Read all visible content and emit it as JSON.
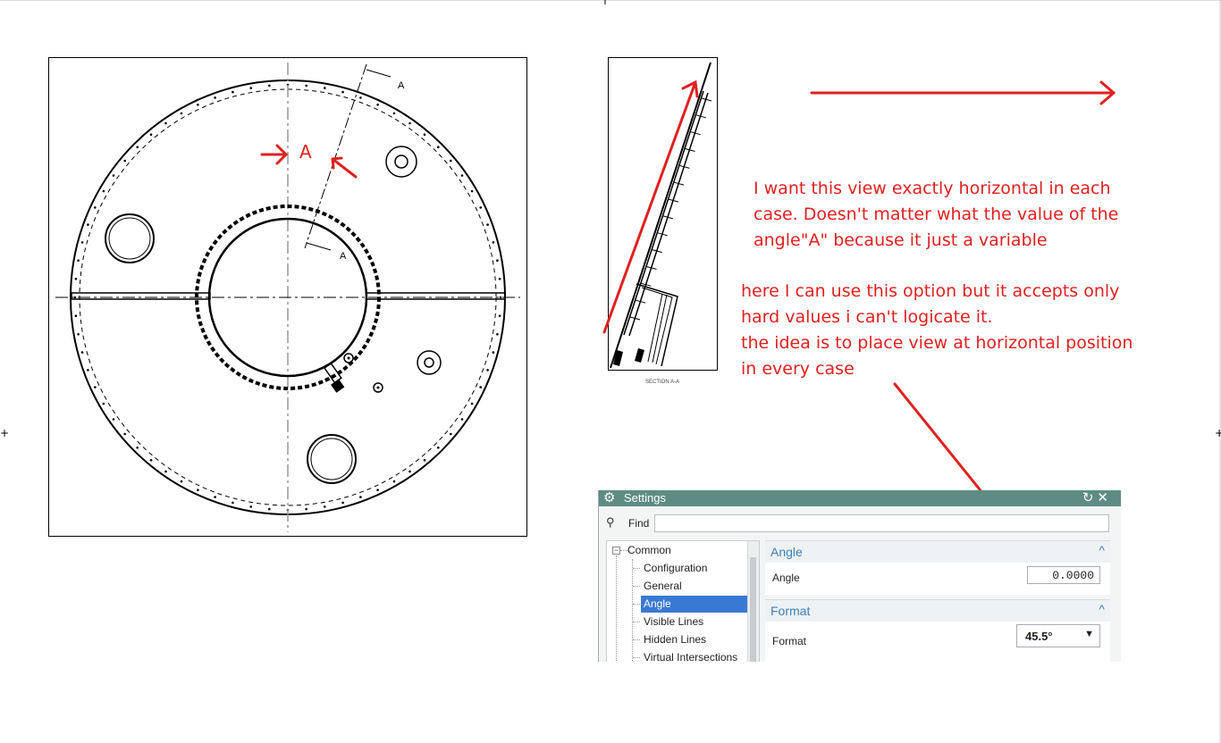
{
  "drawing": {
    "section_marker_A": "A",
    "cut_label_top": "A",
    "cut_label_bottom": "A",
    "section_caption": "SECTION A-A"
  },
  "notes": {
    "note1": "I want this view exactly horizontal in each\ncase. Doesn't matter what the value of the\nangle\"A\" because it just a variable",
    "note2": "here I can use this option but it accepts only\nhard values i can't logicate it.\nthe idea is to place view at horizontal position\nin every case"
  },
  "settings": {
    "title": "Settings",
    "title_icon": "gear-icon",
    "reset_icon": "reset-icon",
    "close_icon": "close-icon",
    "find_label": "Find",
    "find_value": "",
    "tree": {
      "root": "Common",
      "items": [
        "Configuration",
        "General",
        "Angle",
        "Visible Lines",
        "Hidden Lines",
        "Virtual Intersections"
      ],
      "selected": "Angle"
    },
    "angle_group": {
      "header": "Angle",
      "label": "Angle",
      "value": "0.0000"
    },
    "format_group": {
      "header": "Format",
      "label": "Format",
      "value": "45.5°"
    }
  },
  "colors": {
    "annotation_red": "#e02020",
    "highlight_blue": "#1020c8",
    "dialog_title_bar": "#5e8c84",
    "tree_selection": "#3a79d3"
  }
}
